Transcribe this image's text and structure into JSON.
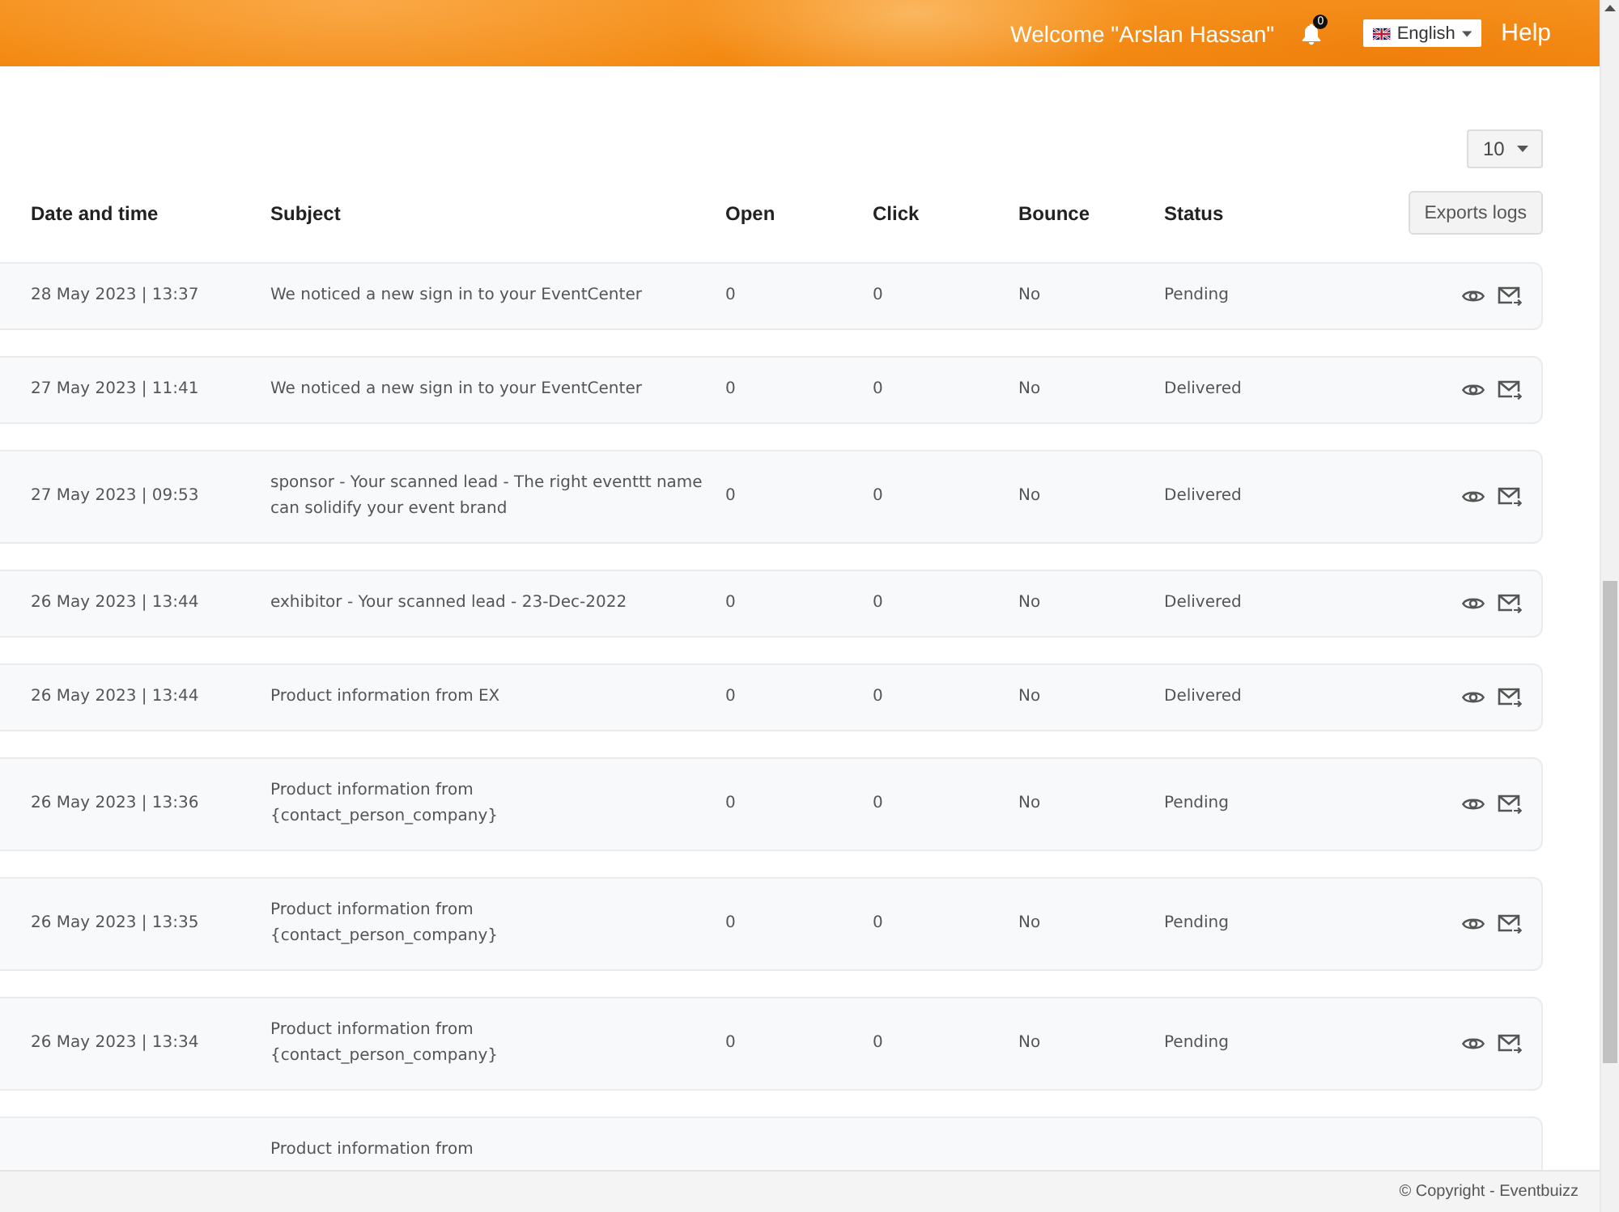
{
  "header": {
    "welcome": "Welcome \"Arslan Hassan\"",
    "notification_count": "0",
    "language": "English",
    "help": "Help"
  },
  "page_size": "10",
  "table": {
    "columns": [
      "Date and time",
      "Subject",
      "Open",
      "Click",
      "Bounce",
      "Status"
    ],
    "export_button": "Exports logs",
    "rows": [
      {
        "date_time": "28 May 2023 | 13:37",
        "subject": "We noticed a new sign in to your EventCenter",
        "open": "0",
        "click": "0",
        "bounce": "No",
        "status": "Pending",
        "actions": true
      },
      {
        "date_time": "27 May 2023 | 11:41",
        "subject": "We noticed a new sign in to your EventCenter",
        "open": "0",
        "click": "0",
        "bounce": "No",
        "status": "Delivered",
        "actions": true
      },
      {
        "date_time": "27 May 2023 | 09:53",
        "subject": "sponsor - Your scanned lead - The right eventtt name can solidify your event brand",
        "open": "0",
        "click": "0",
        "bounce": "No",
        "status": "Delivered",
        "actions": true
      },
      {
        "date_time": "26 May 2023 | 13:44",
        "subject": "exhibitor - Your scanned lead - 23-Dec-2022",
        "open": "0",
        "click": "0",
        "bounce": "No",
        "status": "Delivered",
        "actions": true
      },
      {
        "date_time": "26 May 2023 | 13:44",
        "subject": "Product information from EX",
        "open": "0",
        "click": "0",
        "bounce": "No",
        "status": "Delivered",
        "actions": true
      },
      {
        "date_time": "26 May 2023 | 13:36",
        "subject": "Product information from {contact_person_company}",
        "open": "0",
        "click": "0",
        "bounce": "No",
        "status": "Pending",
        "actions": true
      },
      {
        "date_time": "26 May 2023 | 13:35",
        "subject": "Product information from {contact_person_company}",
        "open": "0",
        "click": "0",
        "bounce": "No",
        "status": "Pending",
        "actions": true
      },
      {
        "date_time": "26 May 2023 | 13:34",
        "subject": "Product information from {contact_person_company}",
        "open": "0",
        "click": "0",
        "bounce": "No",
        "status": "Pending",
        "actions": true
      },
      {
        "subject": "Product information from",
        "actions": false
      }
    ]
  },
  "footer": {
    "copyright": "© Copyright - Eventbuizz"
  }
}
